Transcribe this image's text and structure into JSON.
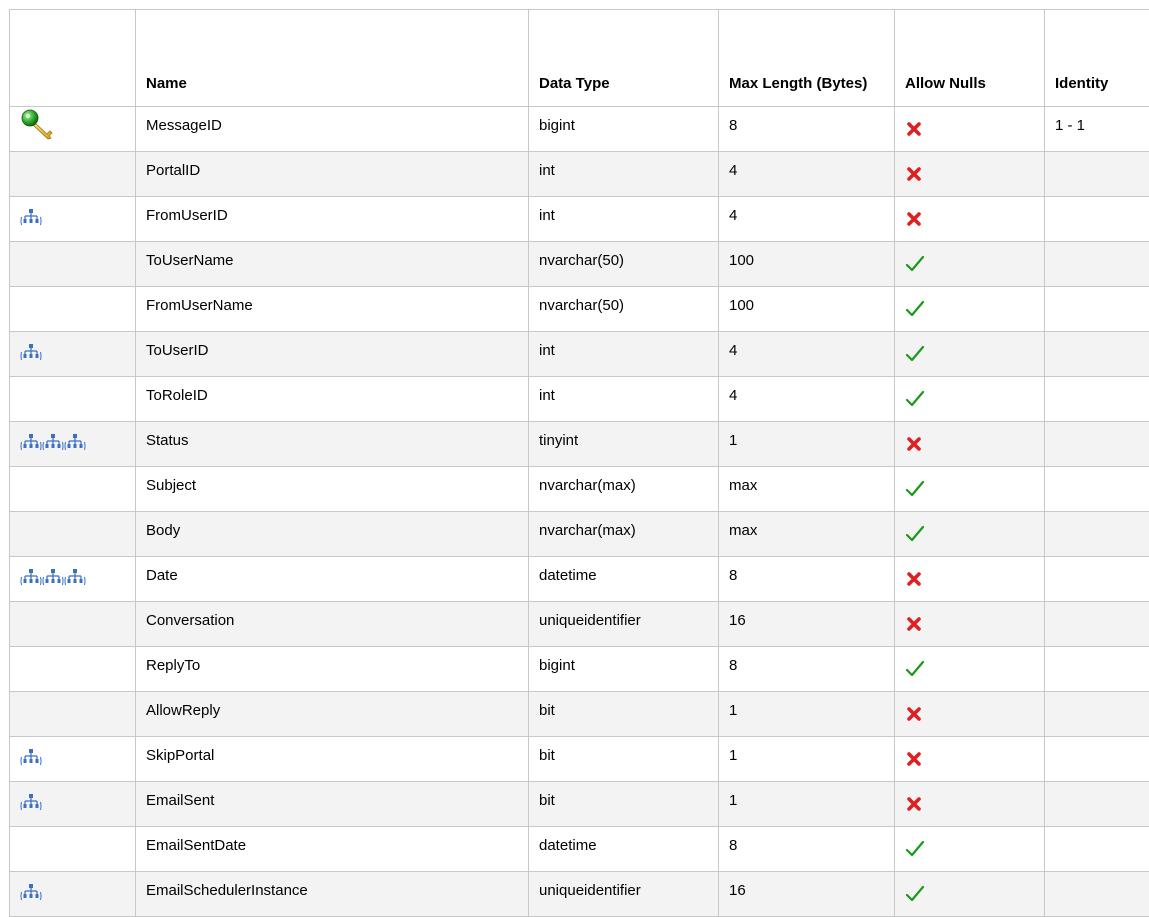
{
  "table": {
    "headers": {
      "keys": "",
      "name": "Name",
      "data_type": "Data Type",
      "max_length": "Max Length (Bytes)",
      "allow_nulls": "Allow Nulls",
      "identity": "Identity"
    },
    "rows": [
      {
        "key": "primary-key",
        "name": "MessageID",
        "data_type": "bigint",
        "max_length": "8",
        "allow_nulls": false,
        "identity": "1 - 1"
      },
      {
        "key": "none",
        "name": "PortalID",
        "data_type": "int",
        "max_length": "4",
        "allow_nulls": false,
        "identity": ""
      },
      {
        "key": "index-1",
        "name": "FromUserID",
        "data_type": "int",
        "max_length": "4",
        "allow_nulls": false,
        "identity": ""
      },
      {
        "key": "none",
        "name": "ToUserName",
        "data_type": "nvarchar(50)",
        "max_length": "100",
        "allow_nulls": true,
        "identity": ""
      },
      {
        "key": "none",
        "name": "FromUserName",
        "data_type": "nvarchar(50)",
        "max_length": "100",
        "allow_nulls": true,
        "identity": ""
      },
      {
        "key": "index-1",
        "name": "ToUserID",
        "data_type": "int",
        "max_length": "4",
        "allow_nulls": true,
        "identity": ""
      },
      {
        "key": "none",
        "name": "ToRoleID",
        "data_type": "int",
        "max_length": "4",
        "allow_nulls": true,
        "identity": ""
      },
      {
        "key": "index-3",
        "name": "Status",
        "data_type": "tinyint",
        "max_length": "1",
        "allow_nulls": false,
        "identity": ""
      },
      {
        "key": "none",
        "name": "Subject",
        "data_type": "nvarchar(max)",
        "max_length": "max",
        "allow_nulls": true,
        "identity": ""
      },
      {
        "key": "none",
        "name": "Body",
        "data_type": "nvarchar(max)",
        "max_length": "max",
        "allow_nulls": true,
        "identity": ""
      },
      {
        "key": "index-3",
        "name": "Date",
        "data_type": "datetime",
        "max_length": "8",
        "allow_nulls": false,
        "identity": ""
      },
      {
        "key": "none",
        "name": "Conversation",
        "data_type": "uniqueidentifier",
        "max_length": "16",
        "allow_nulls": false,
        "identity": ""
      },
      {
        "key": "none",
        "name": "ReplyTo",
        "data_type": "bigint",
        "max_length": "8",
        "allow_nulls": true,
        "identity": ""
      },
      {
        "key": "none",
        "name": "AllowReply",
        "data_type": "bit",
        "max_length": "1",
        "allow_nulls": false,
        "identity": ""
      },
      {
        "key": "index-1",
        "name": "SkipPortal",
        "data_type": "bit",
        "max_length": "1",
        "allow_nulls": false,
        "identity": ""
      },
      {
        "key": "index-1",
        "name": "EmailSent",
        "data_type": "bit",
        "max_length": "1",
        "allow_nulls": false,
        "identity": ""
      },
      {
        "key": "none",
        "name": "EmailSentDate",
        "data_type": "datetime",
        "max_length": "8",
        "allow_nulls": true,
        "identity": ""
      },
      {
        "key": "index-1",
        "name": "EmailSchedulerInstance",
        "data_type": "uniqueidentifier",
        "max_length": "16",
        "allow_nulls": true,
        "identity": ""
      }
    ]
  },
  "icons": {
    "primary_key": "key-icon",
    "index": "index-hierarchy-icon",
    "allow_true": "checkmark-icon",
    "allow_false": "cross-icon"
  },
  "colors": {
    "check": "#1a9a1a",
    "cross": "#e02020",
    "index_icon": "#3a6fc4",
    "key_ring": "#2fae2f",
    "key_shaft": "#d4a21a",
    "alt_row": "#f3f3f3",
    "grid": "#c8c8c8"
  }
}
